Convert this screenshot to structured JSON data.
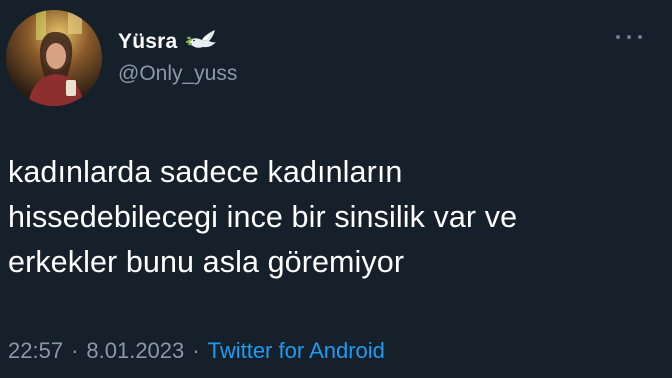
{
  "user": {
    "display_name": "Yüsra",
    "handle": "@Only_yuss",
    "name_emoji_icon": "dove-icon",
    "avatar_icon": "profile-photo"
  },
  "menu": {
    "more_icon": "more-options-icon"
  },
  "tweet": {
    "lines": [
      "kadınlarda sadece kadınların",
      "hissedebilecegi ince bir sinsilik var ve",
      "erkekler bunu asla göremiyor"
    ]
  },
  "meta": {
    "time": "22:57",
    "separator": "·",
    "date": "8.01.2023",
    "source": "Twitter for Android"
  },
  "colors": {
    "background": "#15202b",
    "primary_text": "#ffffff",
    "secondary_text": "#8b98a5",
    "link": "#1d9bf0"
  }
}
